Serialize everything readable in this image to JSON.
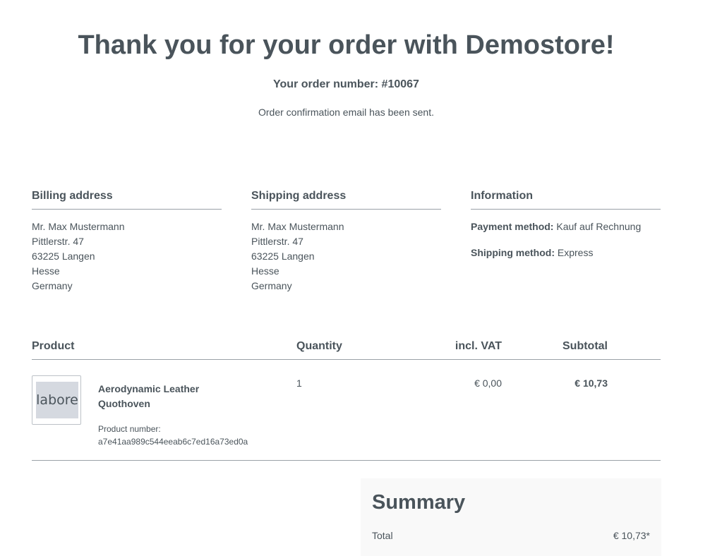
{
  "header": {
    "title": "Thank you for your order with Demostore!",
    "order_number": "Your order number: #10067",
    "confirmation": "Order confirmation email has been sent."
  },
  "billing": {
    "heading": "Billing address",
    "lines": [
      "Mr. Max Mustermann",
      "Pittlerstr. 47",
      "63225 Langen",
      "Hesse",
      "Germany"
    ]
  },
  "shipping": {
    "heading": "Shipping address",
    "lines": [
      "Mr. Max Mustermann",
      "Pittlerstr. 47",
      "63225 Langen",
      "Hesse",
      "Germany"
    ]
  },
  "information": {
    "heading": "Information",
    "payment_label": "Payment method:",
    "payment_value": "Kauf auf Rechnung",
    "shipping_label": "Shipping method:",
    "shipping_value": "Express"
  },
  "table": {
    "headers": {
      "product": "Product",
      "quantity": "Quantity",
      "vat": "incl. VAT",
      "subtotal": "Subtotal"
    },
    "items": [
      {
        "thumb_text": "labore",
        "name": "Aerodynamic Leather Quothoven",
        "number_label": "Product number:",
        "number": "a7e41aa989c544eeab6c7ed16a73ed0a",
        "quantity": "1",
        "vat": "€ 0,00",
        "subtotal": "€ 10,73"
      }
    ]
  },
  "summary": {
    "title": "Summary",
    "total_label": "Total",
    "total_value": "€ 10,73*"
  }
}
